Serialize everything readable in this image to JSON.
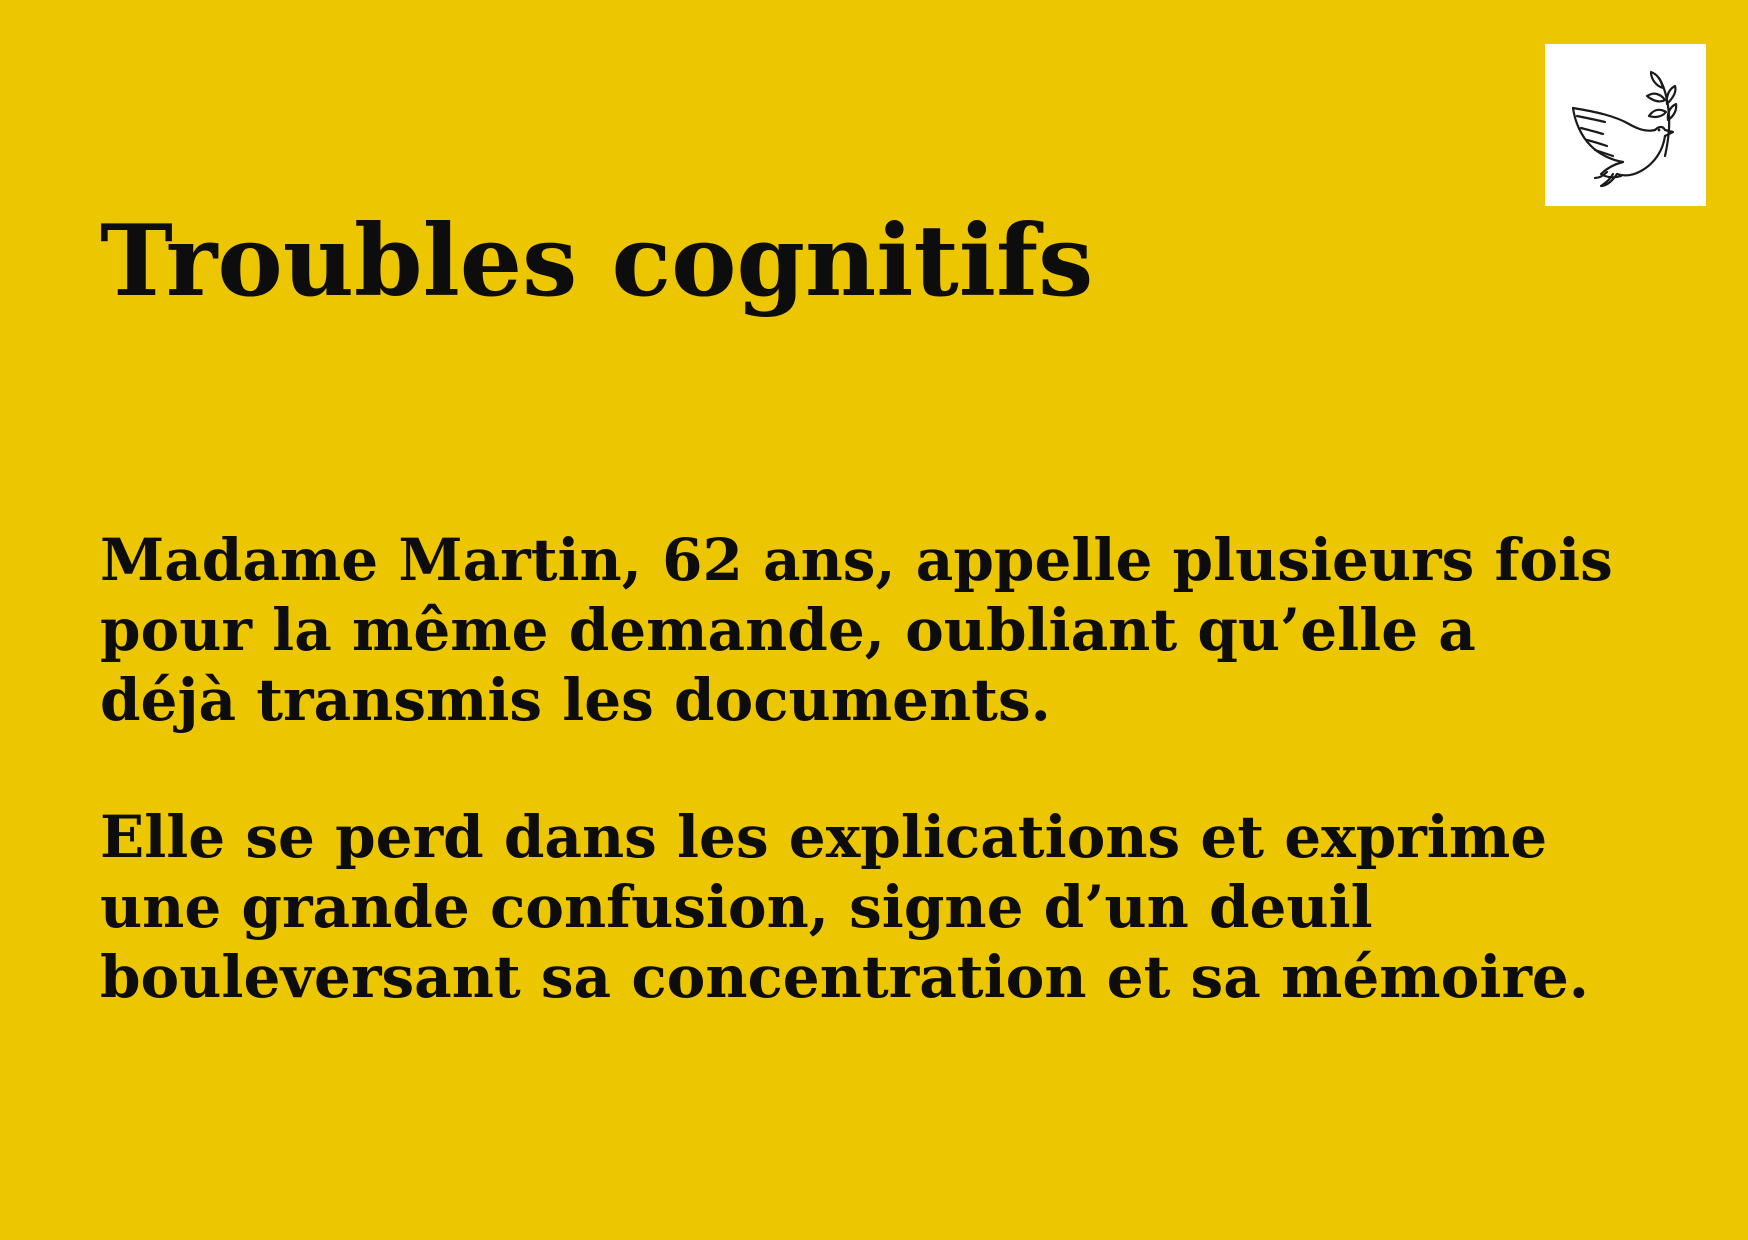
{
  "colors": {
    "background": "#ECC600",
    "text": "#0D0D0D",
    "logo_background": "#FFFFFF"
  },
  "logo": {
    "icon": "dove-with-olive-branch-icon"
  },
  "title": "Troubles cognitifs",
  "paragraphs": [
    "Madame Martin, 62 ans, appelle plusieurs fois pour la même demande, oubliant qu’elle a déjà transmis les documents.",
    "Elle se perd dans les explications et exprime une grande confusion, signe d’un deuil bouleversant sa concentration et sa mémoire."
  ]
}
